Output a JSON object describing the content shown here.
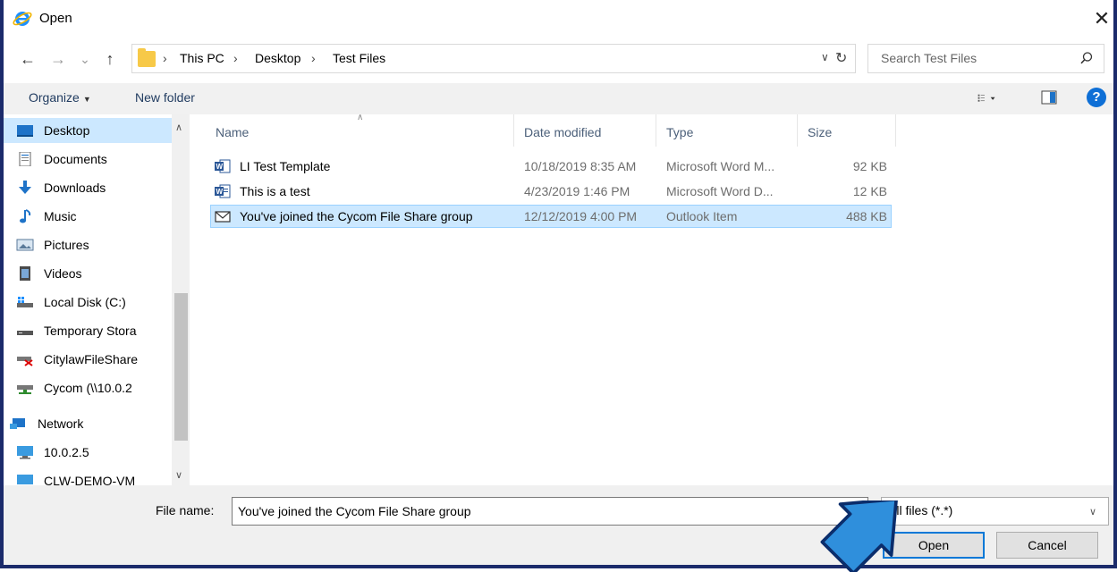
{
  "window": {
    "title": "Open",
    "close_glyph": "✕"
  },
  "nav": {
    "back_glyph": "←",
    "forward_glyph": "→",
    "recent_glyph": "⌄",
    "up_glyph": "↑"
  },
  "address": {
    "crumbs": [
      "This PC",
      "Desktop",
      "Test Files"
    ],
    "separator": "›"
  },
  "search": {
    "placeholder": "Search Test Files"
  },
  "toolbar": {
    "organize": "Organize",
    "organize_caret": "▼",
    "new_folder": "New folder",
    "help": "?"
  },
  "sidebar": {
    "items": [
      {
        "label": "Desktop",
        "icon": "desktop-icon",
        "selected": true
      },
      {
        "label": "Documents",
        "icon": "documents-icon"
      },
      {
        "label": "Downloads",
        "icon": "downloads-icon"
      },
      {
        "label": "Music",
        "icon": "music-icon"
      },
      {
        "label": "Pictures",
        "icon": "pictures-icon"
      },
      {
        "label": "Videos",
        "icon": "videos-icon"
      },
      {
        "label": "Local Disk (C:)",
        "icon": "local-disk-icon"
      },
      {
        "label": "Temporary Stora",
        "icon": "drive-icon"
      },
      {
        "label": "CitylawFileShare",
        "icon": "network-drive-disconnected-icon"
      },
      {
        "label": "Cycom (\\\\10.0.2",
        "icon": "network-drive-icon"
      },
      {
        "label": "Network",
        "icon": "network-icon"
      },
      {
        "label": "10.0.2.5",
        "icon": "computer-icon"
      },
      {
        "label": "CLW-DEMO-VM",
        "icon": "computer-icon"
      }
    ]
  },
  "columns": {
    "name": "Name",
    "date": "Date modified",
    "type": "Type",
    "size": "Size"
  },
  "files": [
    {
      "name": "LI Test Template",
      "date": "10/18/2019 8:35 AM",
      "type": "Microsoft Word M...",
      "size": "92 KB",
      "icon": "word-template-icon"
    },
    {
      "name": "This is a test",
      "date": "4/23/2019 1:46 PM",
      "type": "Microsoft Word D...",
      "size": "12 KB",
      "icon": "word-document-icon"
    },
    {
      "name": "You've joined the Cycom File Share group",
      "date": "12/12/2019 4:00 PM",
      "type": "Outlook Item",
      "size": "488 KB",
      "icon": "mail-icon",
      "selected": true
    }
  ],
  "bottom": {
    "file_name_label": "File name:",
    "file_name_value": "You've joined the Cycom File Share group",
    "filter_value": "All files (*.*)",
    "open_label": "Open",
    "cancel_label": "Cancel"
  },
  "colors": {
    "accent": "#0078d7",
    "selection": "#cce8ff",
    "frame": "#1b2b6b"
  }
}
